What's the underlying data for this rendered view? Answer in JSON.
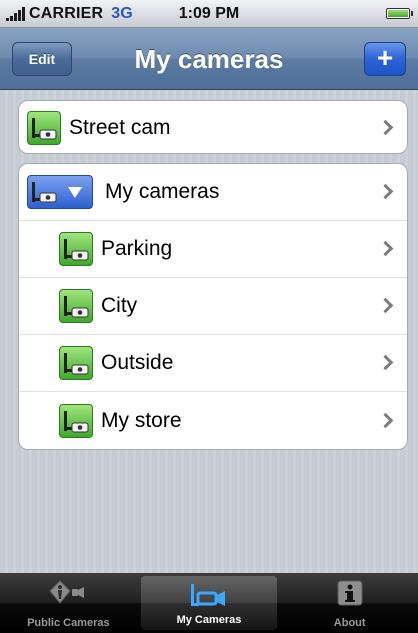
{
  "status_bar": {
    "carrier": "CARRIER",
    "network": "3G",
    "time": "1:09 PM"
  },
  "nav": {
    "title": "My cameras",
    "edit_label": "Edit",
    "add_label": "+"
  },
  "list": {
    "group1": [
      {
        "label": "Street cam",
        "icon": "camera-icon"
      }
    ],
    "group2_header": {
      "label": "My cameras",
      "icon": "camera-group-expand-icon"
    },
    "group2_items": [
      {
        "label": "Parking",
        "icon": "camera-icon"
      },
      {
        "label": "City",
        "icon": "camera-icon"
      },
      {
        "label": "Outside",
        "icon": "camera-icon"
      },
      {
        "label": "My store",
        "icon": "camera-icon"
      }
    ]
  },
  "tabs": [
    {
      "label": "Public Cameras",
      "icon": "public-camera-icon",
      "active": false
    },
    {
      "label": "My Cameras",
      "icon": "video-camera-icon",
      "active": true
    },
    {
      "label": "About",
      "icon": "info-icon",
      "active": false
    }
  ],
  "colors": {
    "nav_blue": "#6e8bb0",
    "add_button": "#2d62d6",
    "camera_icon_green": "#3fa92b",
    "group_icon_blue": "#2d5fd1"
  }
}
